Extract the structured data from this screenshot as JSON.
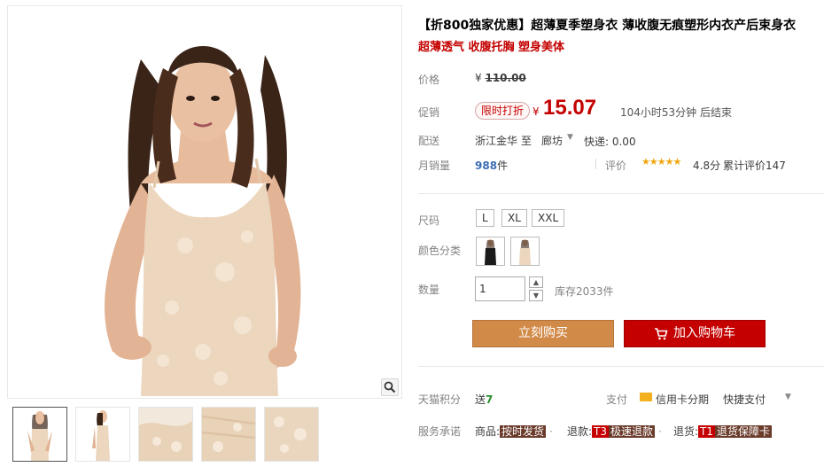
{
  "gallery": {
    "thumbnails": [
      {
        "name": "thumb-front-view",
        "active": true
      },
      {
        "name": "thumb-side-view",
        "active": false
      },
      {
        "name": "thumb-fabric-detail-1",
        "active": false
      },
      {
        "name": "thumb-fabric-detail-2",
        "active": false
      },
      {
        "name": "thumb-fabric-detail-3",
        "active": false
      }
    ],
    "zoom_icon": "magnifier-icon"
  },
  "product": {
    "title": "【折800独家优惠】超薄夏季塑身衣 薄收腹无痕塑形内衣产后束身衣",
    "subtitle": "超薄透气 收腹托胸 塑身美体"
  },
  "price": {
    "label": "价格",
    "currency": "¥",
    "original": "110.00"
  },
  "promo": {
    "label": "促销",
    "tag": "限时打折",
    "currency": "¥",
    "price": "15.07",
    "countdown": "104小时53分钟 后结束"
  },
  "shipping": {
    "label": "配送",
    "from": "浙江金华",
    "to_word": "至",
    "city": "廊坊",
    "fee": "快递: 0.00"
  },
  "sales": {
    "label": "月销量",
    "count": "988",
    "unit": "件",
    "rating_label": "评价",
    "stars": "★★★★★",
    "score": "4.8分",
    "review_total": "累计评价147"
  },
  "options": {
    "size_label": "尺码",
    "sizes": [
      "L",
      "XL",
      "XXL"
    ],
    "color_label": "颜色分类",
    "qty_label": "数量",
    "qty_value": "1",
    "stock": "库存2033件"
  },
  "actions": {
    "buy_now": "立刻购买",
    "add_cart": "加入购物车"
  },
  "extras": {
    "points_label": "天猫积分",
    "points_prefix": "送",
    "points_value": "7",
    "pay_label": "支付",
    "card_pay": "信用卡分期",
    "quick_pay": "快捷支付",
    "service_label": "服务承诺",
    "svc1_prefix": "商品:",
    "svc1_tag": "按时发货",
    "svc2_prefix": "退款:",
    "svc2_code": "T3",
    "svc2_tag": "极速退款",
    "svc3_prefix": "退货:",
    "svc3_code": "T1",
    "svc3_tag": "退货保障卡"
  },
  "colors": {
    "accent_red": "#c40000",
    "buy_orange": "#d18a48",
    "skin_beige": "#ecd6bd"
  }
}
